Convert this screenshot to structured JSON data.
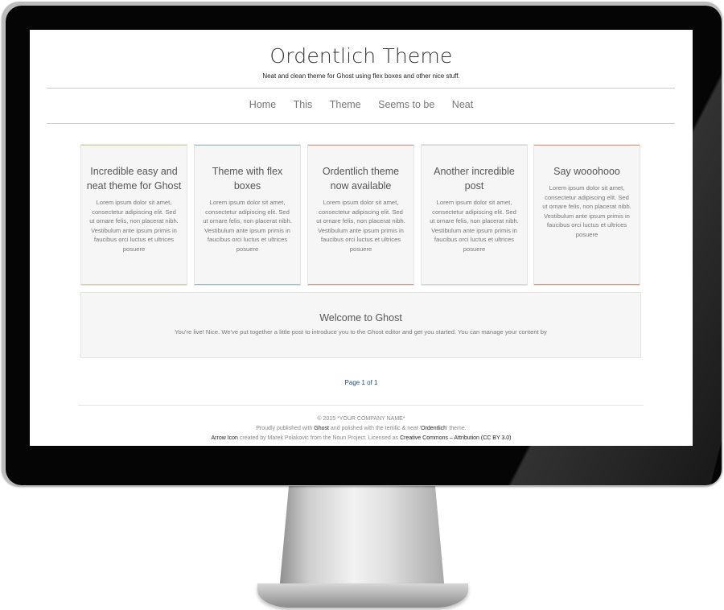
{
  "site": {
    "title": "Ordentlich Theme",
    "description": "Neat and clean theme for Ghost using flex boxes and other nice stuff."
  },
  "nav": {
    "items": [
      "Home",
      "This",
      "Theme",
      "Seems to be",
      "Neat"
    ]
  },
  "cards": [
    {
      "title": "Incredible easy and neat theme for Ghost",
      "excerpt": "Lorem ipsum dolor sit amet, consectetur adipiscing elit. Sed ut ornare felis, non placerat nibh. Vestibulum ante ipsum primis in faucibus orci luctus et ultrices posuere",
      "color": "#d9d49a"
    },
    {
      "title": "Theme with flex boxes",
      "excerpt": "Lorem ipsum dolor sit amet, consectetur adipiscing elit. Sed ut ornare felis, non placerat nibh. Vestibulum ante ipsum primis in faucibus orci luctus et ultrices posuere",
      "color": "#9cc4c9"
    },
    {
      "title": "Ordentlich theme now available",
      "excerpt": "Lorem ipsum dolor sit amet, consectetur adipiscing elit. Sed ut ornare felis, non placerat nibh. Vestibulum ante ipsum primis in faucibus orci luctus et ultrices posuere",
      "color": "#e0a28f"
    },
    {
      "title": "Another incredible post",
      "excerpt": "Lorem ipsum dolor sit amet, consectetur adipiscing elit. Sed ut ornare felis, non placerat nibh. Vestibulum ante ipsum primis in faucibus orci luctus et ultrices posuere",
      "color": "#d8d8d8"
    },
    {
      "title": "Say wooohooo",
      "excerpt": "Lorem ipsum dolor sit amet, consectetur adipiscing elit. Sed ut ornare felis, non placerat nibh. Vestibulum ante ipsum primis in faucibus orci luctus et ultrices posuere",
      "color": "#e2a07c"
    }
  ],
  "welcome": {
    "title": "Welcome to Ghost",
    "excerpt": "You're live! Nice. We've put together a little post to introduce you to the Ghost editor and get you started. You can manage your content by"
  },
  "pagination": {
    "label": "Page 1 of 1"
  },
  "footer": {
    "copyright": "© 2015 *YOUR COMPANY NAME*",
    "line2_prefix": "Proudly published with",
    "ghost_link": "Ghost",
    "line2_middle": "and polished with the terrific & neat '",
    "theme_link": "Ordentlich",
    "line2_suffix": "' theme.",
    "arrow_link": "Arrow Icon",
    "line3_middle": "created by Marek Polakovic from the Noun Project. Licensed as",
    "license_link": "Creative Commons – Attribution (CC BY 3.0)"
  }
}
